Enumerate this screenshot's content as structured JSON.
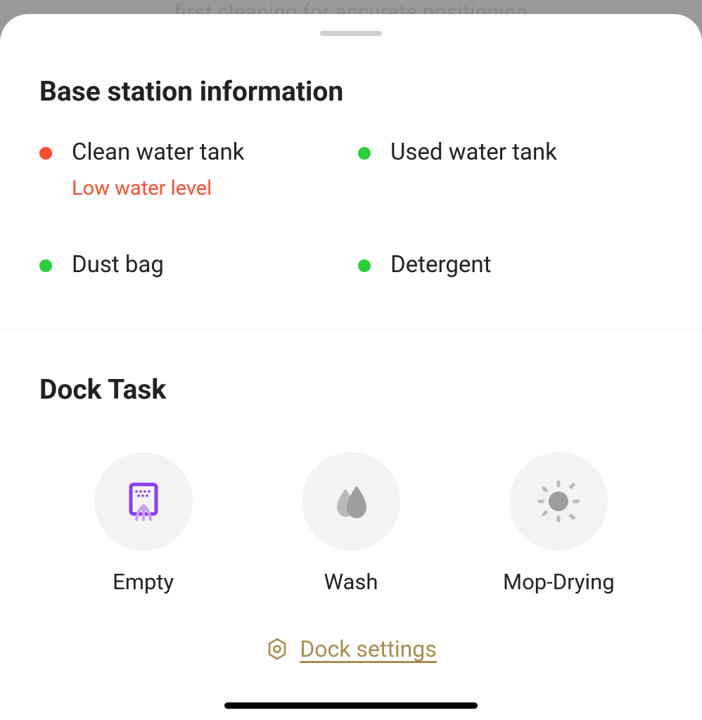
{
  "backdrop": "first cleaning for accurate positioning",
  "section_title": "Base station information",
  "status": {
    "clean_water": {
      "label": "Clean water tank",
      "sub": "Low water level"
    },
    "used_water": {
      "label": "Used water tank"
    },
    "dust_bag": {
      "label": "Dust bag"
    },
    "detergent": {
      "label": "Detergent"
    }
  },
  "dock_title": "Dock Task",
  "tasks": {
    "empty": {
      "label": "Empty"
    },
    "wash": {
      "label": "Wash"
    },
    "mop_drying": {
      "label": "Mop-Drying"
    }
  },
  "settings_label": "Dock settings"
}
